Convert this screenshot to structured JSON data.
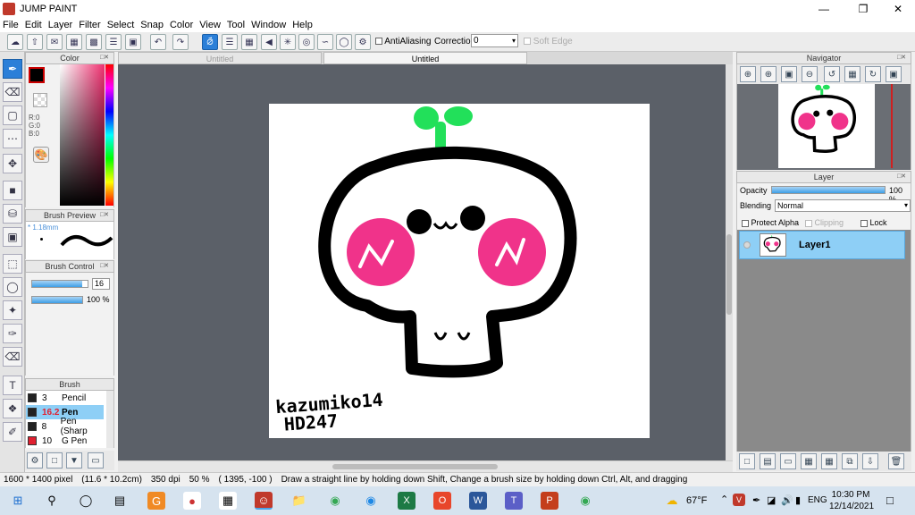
{
  "window": {
    "title": "JUMP PAINT",
    "minimize_icon": "minimize-icon",
    "maximize_icon": "restore-icon",
    "close_icon": "close-icon"
  },
  "menu": [
    "File",
    "Edit",
    "Layer",
    "Filter",
    "Select",
    "Snap",
    "Color",
    "View",
    "Tool",
    "Window",
    "Help"
  ],
  "toolbar": {
    "antialiasing_label": "AntiAliasing",
    "correction_label": "Correction",
    "correction_value": "0",
    "soft_edge_label": "Soft Edge"
  },
  "color_panel": {
    "title": "Color",
    "r_label": "R:0",
    "g_label": "G:0",
    "b_label": "B:0",
    "primary_color": "#000000",
    "secondary_color": "#ffffff"
  },
  "brush_preview": {
    "title": "Brush Preview",
    "size_label": "* 1.18mm"
  },
  "brush_control": {
    "title": "Brush Control",
    "size_value": "16",
    "opacity_value": "100 %",
    "opacity_level": 1.0,
    "size_level": 0.9
  },
  "brush_panel": {
    "title": "Brush",
    "items": [
      {
        "size": "3",
        "name": "Pencil",
        "color": "#222222",
        "selected": false
      },
      {
        "size": "16.2",
        "name": "Pen",
        "color": "#222222",
        "selected": true
      },
      {
        "size": "8",
        "name": "Pen (Sharp",
        "color": "#222222",
        "selected": false
      },
      {
        "size": "10",
        "name": "G Pen",
        "color": "#e02030",
        "selected": false
      }
    ]
  },
  "tabs": [
    "Untitled",
    "Untitled"
  ],
  "canvas_art": {
    "signature_line1": "kazumiko14",
    "signature_line2": "HD247"
  },
  "navigator": {
    "title": "Navigator"
  },
  "layer_panel": {
    "title": "Layer",
    "opacity_label": "Opacity",
    "opacity_value": "100 %",
    "opacity_level": 1.0,
    "blending_label": "Blending",
    "blending_value": "Normal",
    "protect_alpha_label": "Protect Alpha",
    "clipping_label": "Clipping",
    "lock_label": "Lock",
    "layers": [
      {
        "name": "Layer1",
        "selected": true
      }
    ]
  },
  "status": {
    "size": "1600 * 1400 pixel",
    "cm": "(11.6 * 10.2cm)",
    "dpi": "350 dpi",
    "zoom": "50 %",
    "coords": "( 1395, -100 )",
    "hint": "Draw a straight line by holding down Shift, Change a brush size by holding down Ctrl, Alt, and dragging"
  },
  "taskbar": {
    "weather": "67°F",
    "language": "ENG",
    "time": "10:30 PM",
    "date": "12/14/2021"
  }
}
